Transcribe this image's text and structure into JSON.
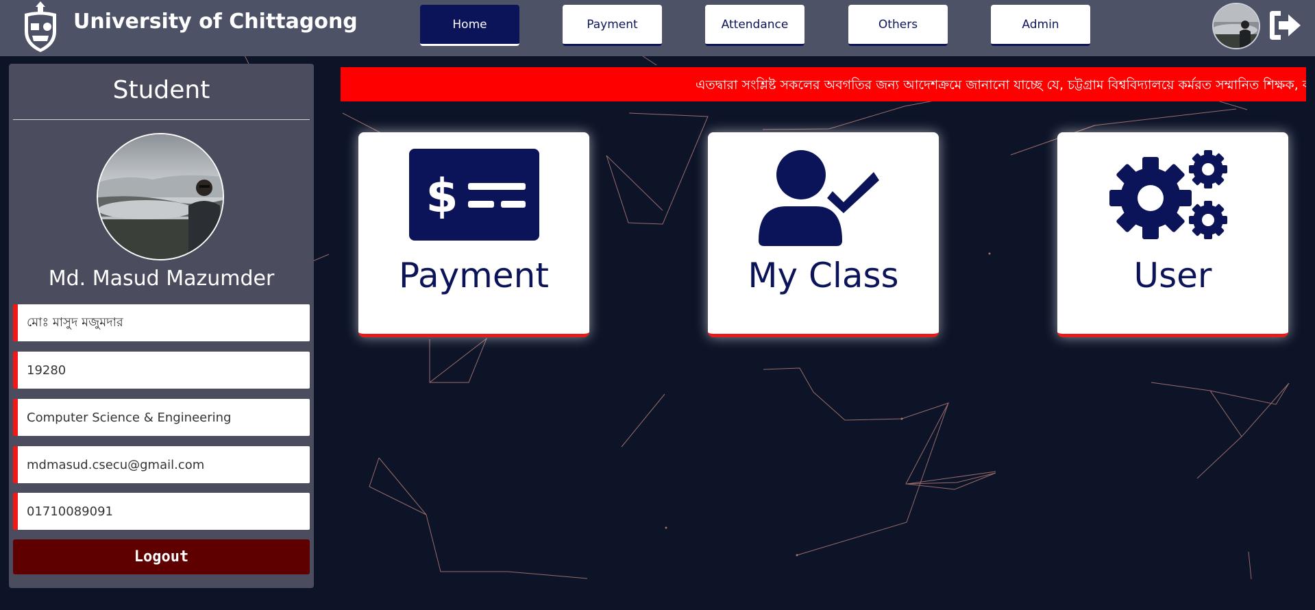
{
  "header": {
    "university_name": "University of Chittagong",
    "nav": [
      {
        "label": "Home",
        "active": true
      },
      {
        "label": "Payment",
        "active": false
      },
      {
        "label": "Attendance",
        "active": false
      },
      {
        "label": "Others",
        "active": false
      },
      {
        "label": "Admin",
        "active": false
      }
    ],
    "icons": {
      "logo": "university-crest-icon",
      "exit": "sign-out-icon"
    }
  },
  "sidebar": {
    "title": "Student",
    "name": "Md. Masud Mazumder",
    "fields": {
      "name_bangla": "মোঃ মাসুদ মজুমদার",
      "student_id": "19280",
      "department": "Computer Science & Engineering",
      "email": "mdmasud.csecu@gmail.com",
      "phone": "01710089091"
    },
    "logout_label": "Logout"
  },
  "notice": {
    "text": "এতদ্বারা সংশ্লিষ্ট সকলের অবগতির জন্য আদেশক্রমে জানানো যাচ্ছে যে, চট্টগ্রাম বিশ্ববিদ্যালয়ে কর্মরত সম্মানিত শিক্ষক, ক"
  },
  "cards": [
    {
      "label": "Payment",
      "icon": "payment-card-icon"
    },
    {
      "label": "My Class",
      "icon": "user-check-icon"
    },
    {
      "label": "User",
      "icon": "gears-icon"
    }
  ],
  "colors": {
    "background": "#0d1428",
    "header": "#4d5266",
    "sidebar": "#4b4c5d",
    "navy": "#0c1459",
    "notice": "#ff0000",
    "accent_red": "#e81b1b",
    "logout": "#5e0000"
  }
}
